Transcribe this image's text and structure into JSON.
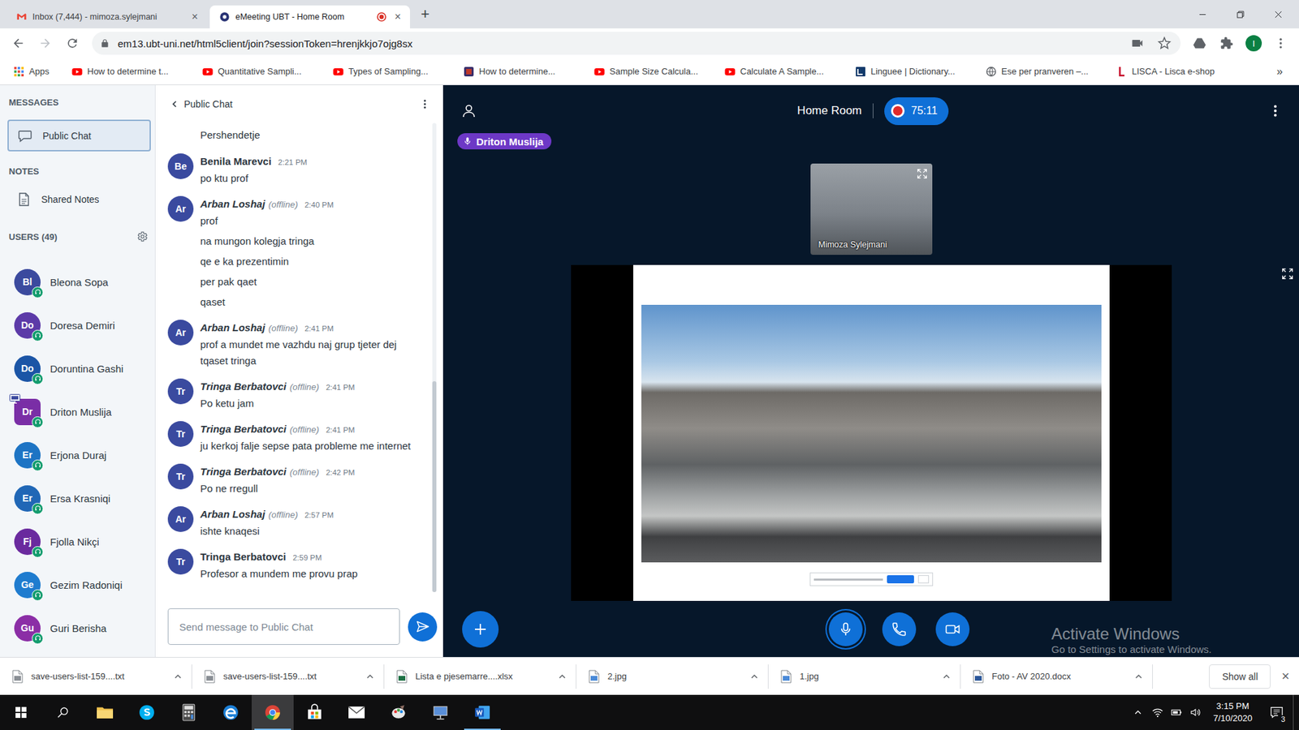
{
  "browser": {
    "tabs": [
      {
        "title": "Inbox (7,444) - mimoza.sylejmani",
        "kind": "gmail",
        "selected": false,
        "recording": false,
        "close": "×"
      },
      {
        "title": "eMeeting UBT - Home Room",
        "kind": "meeting",
        "selected": true,
        "recording": true,
        "close": "×"
      }
    ],
    "new_tab": "+",
    "url": "em13.ubt-uni.net/html5client/join?sessionToken=hrenjkkjo7ojg8sx",
    "forward_enabled": false,
    "profile": "I",
    "bookmarks": [
      {
        "label": "Apps",
        "kind": "apps"
      },
      {
        "label": "How to determine t...",
        "kind": "youtube"
      },
      {
        "label": "Quantitative Sampli...",
        "kind": "youtube"
      },
      {
        "label": "Types of Sampling...",
        "kind": "youtube"
      },
      {
        "label": "How to determine...",
        "kind": "page"
      },
      {
        "label": "Sample Size Calcula...",
        "kind": "youtube"
      },
      {
        "label": "Calculate A Sample...",
        "kind": "youtube"
      },
      {
        "label": "Linguee | Dictionary...",
        "kind": "linguee"
      },
      {
        "label": "Ese per pranveren –...",
        "kind": "globe"
      },
      {
        "label": "LISCA - Lisca e-shop",
        "kind": "lisca"
      }
    ],
    "bookmarks_more": "»"
  },
  "sidebar": {
    "messages_title": "MESSAGES",
    "chats": [
      {
        "label": "Public Chat",
        "selected": true
      }
    ],
    "notes_title": "NOTES",
    "notes": [
      {
        "label": "Shared Notes"
      }
    ],
    "users_title": "USERS (49)",
    "users": [
      {
        "initials": "Bl",
        "name": "Bleona Sopa",
        "color": "#3b4a9e",
        "presenter": false,
        "listen_only": true
      },
      {
        "initials": "Do",
        "name": "Doresa Demiri",
        "color": "#5c3aa8",
        "presenter": false,
        "listen_only": true
      },
      {
        "initials": "Do",
        "name": "Doruntina Gashi",
        "color": "#1b55a6",
        "presenter": false,
        "listen_only": true
      },
      {
        "initials": "Dr",
        "name": "Driton Muslija",
        "color": "#7a2ea6",
        "presenter": true,
        "listen_only": true
      },
      {
        "initials": "Er",
        "name": "Erjona Duraj",
        "color": "#1d74c4",
        "presenter": false,
        "listen_only": true
      },
      {
        "initials": "Er",
        "name": "Ersa Krasniqi",
        "color": "#2067b6",
        "presenter": false,
        "listen_only": true
      },
      {
        "initials": "Fj",
        "name": "Fjolla Nikçi",
        "color": "#6a2a9e",
        "presenter": false,
        "listen_only": true
      },
      {
        "initials": "Ge",
        "name": "Gezim Radoniqi",
        "color": "#1f7ccf",
        "presenter": false,
        "listen_only": true
      },
      {
        "initials": "Gu",
        "name": "Guri Berisha",
        "color": "#8b2ea6",
        "presenter": false,
        "listen_only": true
      }
    ]
  },
  "chat": {
    "title": "Public Chat",
    "partial_line": "Pershendetje",
    "offline_label": "(offline)",
    "messages": [
      {
        "initials": "Be",
        "name": "Benila Marevci",
        "offline": false,
        "time": "2:21 PM",
        "lines": [
          "po ktu prof"
        ]
      },
      {
        "initials": "Ar",
        "name": "Arban Loshaj",
        "offline": true,
        "time": "2:40 PM",
        "lines": [
          "prof",
          "na mungon kolegja tringa",
          "qe e ka prezentimin",
          "per pak qaet",
          "qaset"
        ]
      },
      {
        "initials": "Ar",
        "name": "Arban Loshaj",
        "offline": true,
        "time": "2:41 PM",
        "lines": [
          "prof a mundet me vazhdu naj grup tjeter dej tqaset tringa"
        ]
      },
      {
        "initials": "Tr",
        "name": "Tringa Berbatovci",
        "offline": true,
        "time": "2:41 PM",
        "lines": [
          "Po ketu jam"
        ]
      },
      {
        "initials": "Tr",
        "name": "Tringa Berbatovci",
        "offline": true,
        "time": "2:41 PM",
        "lines": [
          "ju kerkoj falje sepse pata probleme me internet"
        ]
      },
      {
        "initials": "Tr",
        "name": "Tringa Berbatovci",
        "offline": true,
        "time": "2:42 PM",
        "lines": [
          "Po ne rregull"
        ]
      },
      {
        "initials": "Ar",
        "name": "Arban Loshaj",
        "offline": true,
        "time": "2:57 PM",
        "lines": [
          "ishte knaqesi"
        ]
      },
      {
        "initials": "Tr",
        "name": "Tringa Berbatovci",
        "offline": false,
        "time": "2:59 PM",
        "lines": [
          "Profesor a mundem me provu prap"
        ]
      }
    ],
    "input_placeholder": "Send message to Public Chat"
  },
  "meeting": {
    "room": "Home Room",
    "recording": true,
    "recording_time": "75:11",
    "talking": "Driton Muslija",
    "webcam_name": "Mimoza Sylejmani",
    "controls": [
      {
        "kind": "mic",
        "active": true
      },
      {
        "kind": "phone",
        "active": false
      },
      {
        "kind": "camera",
        "active": false
      }
    ]
  },
  "watermark": {
    "title": "Activate Windows",
    "subtitle": "Go to Settings to activate Windows."
  },
  "downloads": {
    "items": [
      {
        "name": "save-users-list-159....txt",
        "kind": "txt"
      },
      {
        "name": "save-users-list-159....txt",
        "kind": "txt"
      },
      {
        "name": "Lista e pjesemarre....xlsx",
        "kind": "xlsx"
      },
      {
        "name": "2.jpg",
        "kind": "jpg"
      },
      {
        "name": "1.jpg",
        "kind": "jpg"
      },
      {
        "name": "Foto - AV 2020.docx",
        "kind": "docx"
      }
    ],
    "show_all": "Show all",
    "close": "×"
  },
  "taskbar": {
    "apps": [
      {
        "kind": "start",
        "selected": false,
        "open": false
      },
      {
        "kind": "search",
        "selected": false,
        "open": false
      },
      {
        "kind": "explorer",
        "selected": false,
        "open": false
      },
      {
        "kind": "skype",
        "selected": false,
        "open": false
      },
      {
        "kind": "calculator",
        "selected": false,
        "open": false
      },
      {
        "kind": "edge",
        "selected": false,
        "open": false
      },
      {
        "kind": "chrome",
        "selected": true,
        "open": true
      },
      {
        "kind": "store",
        "selected": false,
        "open": false
      },
      {
        "kind": "mail",
        "selected": false,
        "open": false
      },
      {
        "kind": "paint",
        "selected": false,
        "open": false
      },
      {
        "kind": "network",
        "selected": false,
        "open": false
      },
      {
        "kind": "word",
        "selected": false,
        "open": true
      }
    ],
    "time": "3:15 PM",
    "date": "7/10/2020",
    "notifications": "3"
  }
}
